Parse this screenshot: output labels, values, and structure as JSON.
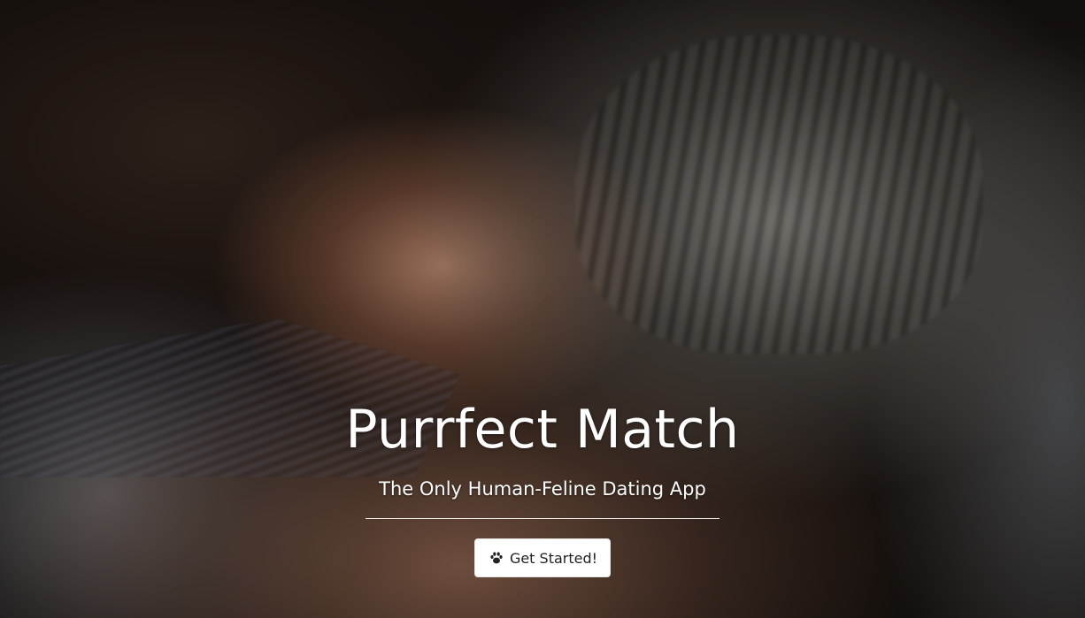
{
  "hero": {
    "title": "Purrfect Match",
    "subtitle": "The Only Human-Feline Dating App",
    "cta": {
      "label": "Get Started!",
      "icon": "paw-icon"
    },
    "background_image": "woman-and-tabby-cat-photo"
  },
  "colors": {
    "text": "#ffffff",
    "button_bg": "#ffffff",
    "button_text": "#222222"
  }
}
